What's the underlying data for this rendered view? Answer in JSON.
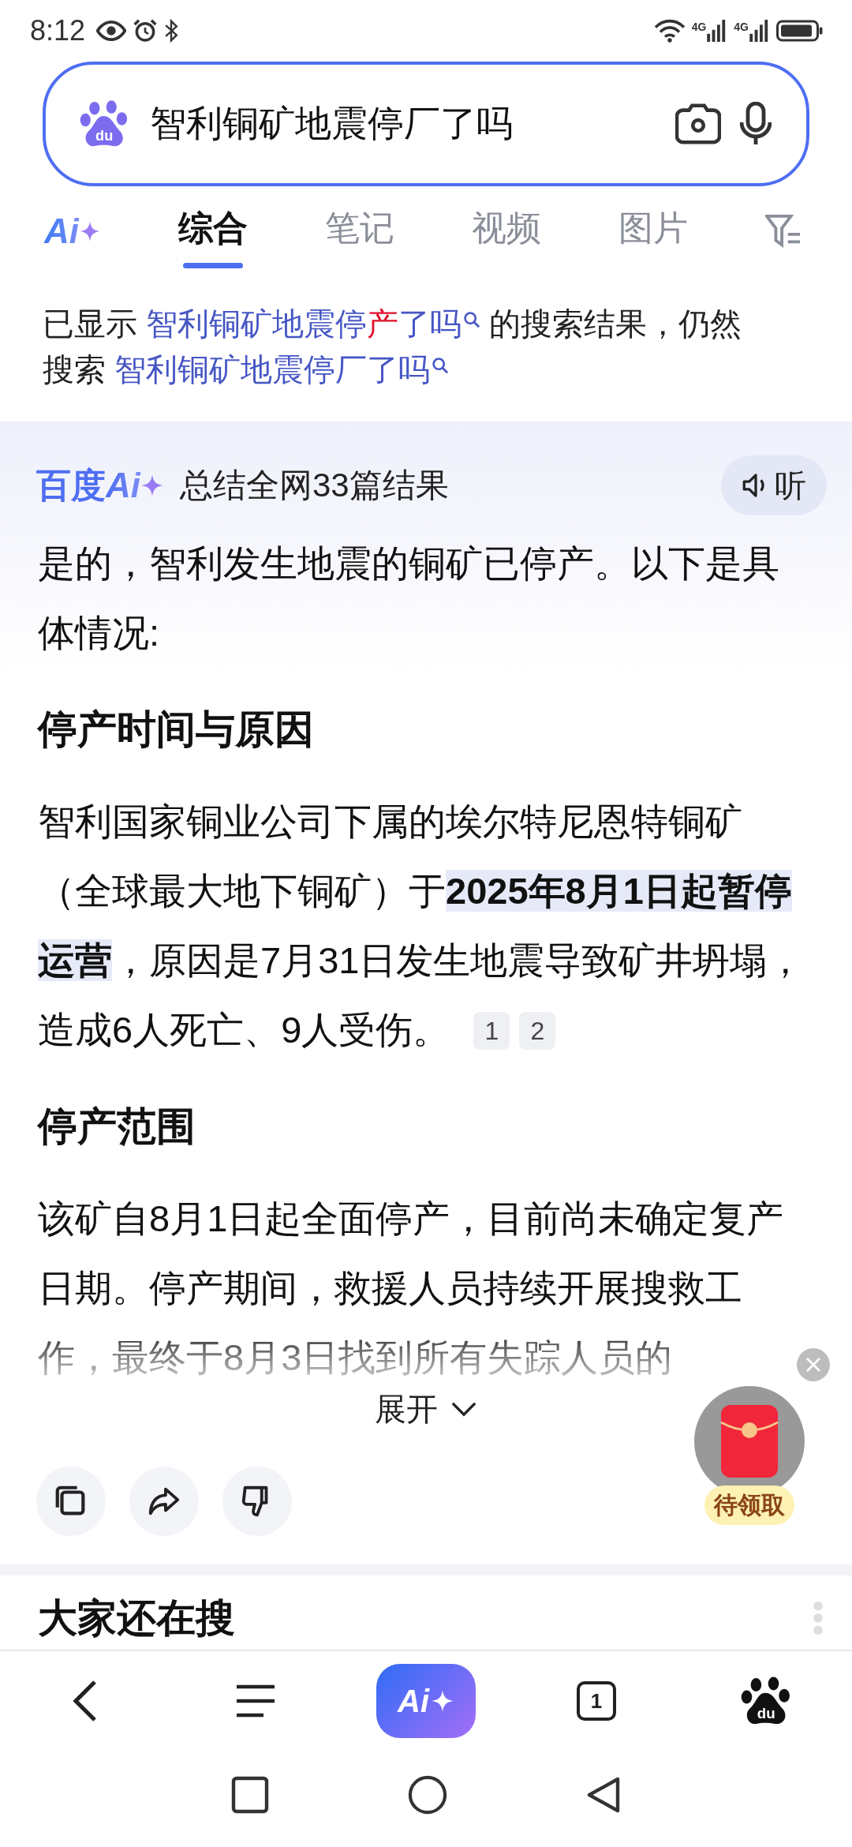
{
  "status_bar": {
    "time": "8:12",
    "network_labels": [
      "4G",
      "4G"
    ]
  },
  "search": {
    "logo_text": "du",
    "value": "智利铜矿地震停厂了吗"
  },
  "ai_tab": {
    "label": "Ai"
  },
  "tabs": [
    {
      "label": "综合",
      "selected": true
    },
    {
      "label": "笔记",
      "selected": false
    },
    {
      "label": "视频",
      "selected": false
    },
    {
      "label": "图片",
      "selected": false
    }
  ],
  "correction": {
    "prefix": "已显示",
    "shown_query": {
      "before": "智利铜矿地震停",
      "changed": "产",
      "after": "了吗"
    },
    "middle": "的搜索结果，仍然搜索",
    "original_query": "智利铜矿地震停厂了吗"
  },
  "ai_answer": {
    "brand": "百度",
    "logo": "Ai",
    "summary": "总结全网33篇结果",
    "listen_label": "听",
    "blocks": [
      {
        "kind": "paragraph",
        "text": "是的，智利发生地震的铜矿已停产。以下是具体情况:"
      },
      {
        "kind": "heading",
        "text": "停产时间与原因"
      },
      {
        "kind": "paragraph",
        "text": "智利国家铜业公司下属的埃尔特尼恩特铜矿（全球最大地下铜矿）于**2025年8月1日起暂停运营**，原因是7月31日发生地震导致矿井坍塌，造成6人死亡、9人受伤。",
        "citations": [
          "1",
          "2"
        ]
      },
      {
        "kind": "heading",
        "text": "停产范围"
      },
      {
        "kind": "paragraph",
        "text": "该矿自8月1日起全面停产，目前尚未确定复产日期。停产期间，救援人员持续开展搜救工作，最终于8月3日找到所有失踪人员的",
        "faded": true
      }
    ],
    "expand_label": "展开",
    "actions": [
      {
        "kind": "copy"
      },
      {
        "kind": "share"
      },
      {
        "kind": "dislike"
      }
    ]
  },
  "red_packet": {
    "label": "待领取"
  },
  "more_searches": {
    "title": "大家还在搜"
  },
  "bottom_nav": {
    "ai_label": "Ai",
    "tab_count": "1",
    "logo_text": "du"
  }
}
